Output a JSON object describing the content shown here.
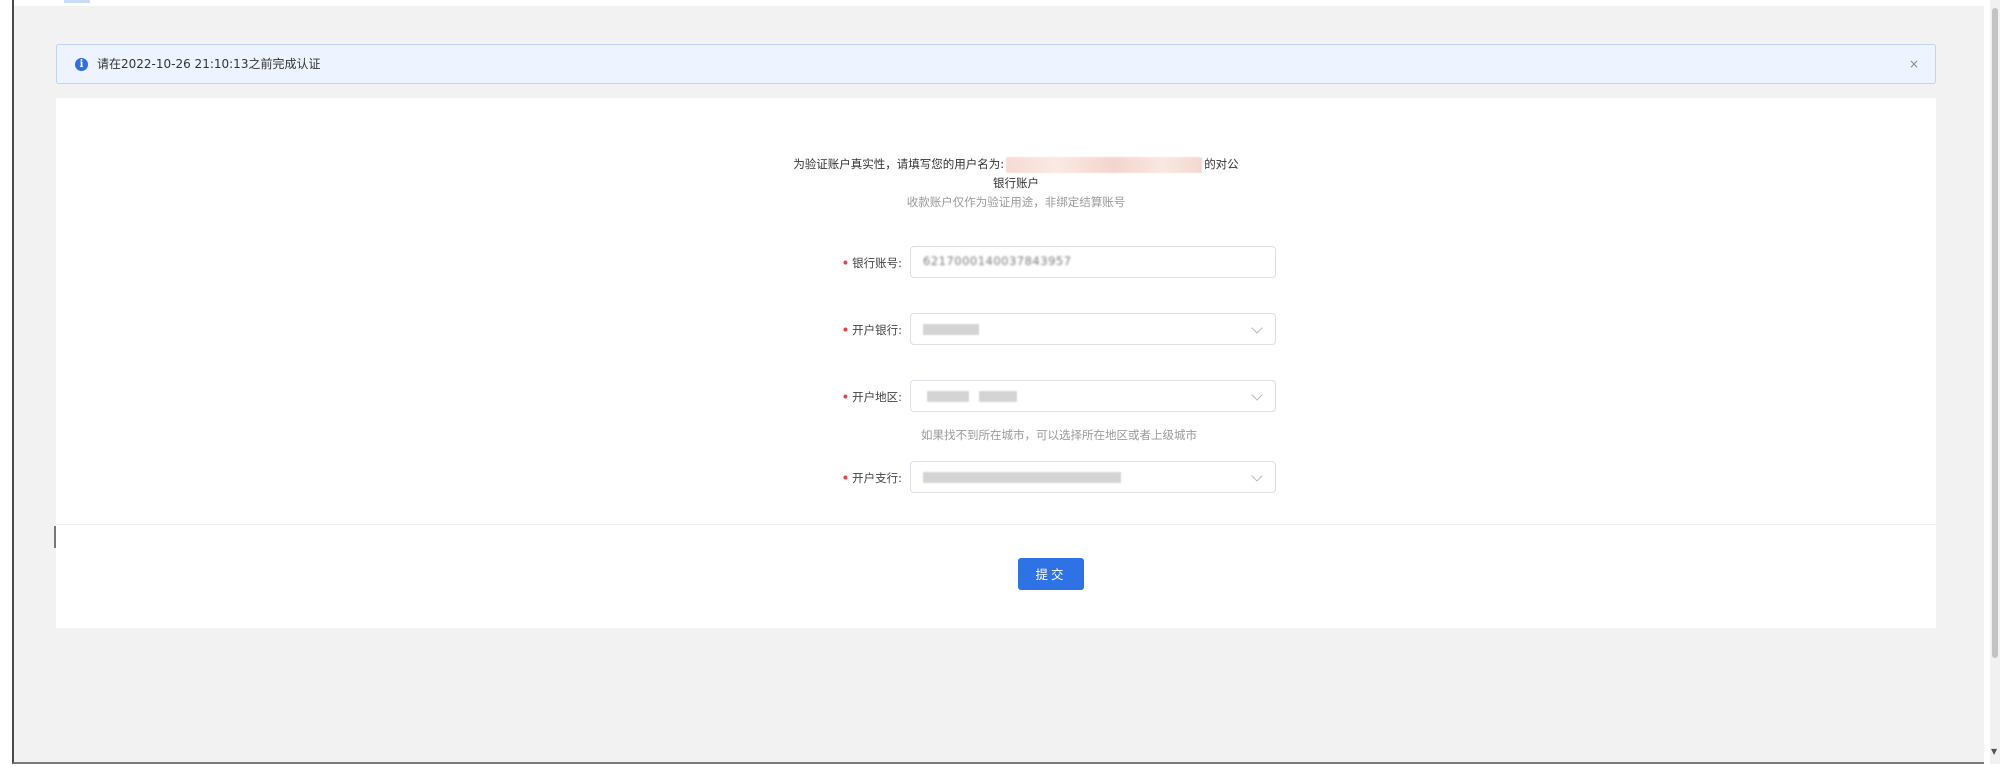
{
  "notice": {
    "text": "请在2022-10-26 21:10:13之前完成认证",
    "close_label": "×",
    "icon": "info-icon"
  },
  "intro": {
    "prefix": "为验证账户真实性，请填写您的用户名为:",
    "suffix": "的对公",
    "line2": "银行账户",
    "line3": "收款账户仅作为验证用途，非绑定结算账号"
  },
  "form": {
    "required_mark": "•",
    "fields": [
      {
        "label": "银行账号:",
        "value": "6217000140037843957",
        "type": "input"
      },
      {
        "label": "开户银行:",
        "type": "select"
      },
      {
        "label": "开户地区:",
        "type": "select"
      },
      {
        "label": "开户支行:",
        "type": "select"
      }
    ],
    "region_hint": "如果找不到所在城市，可以选择所在地区或者上级城市"
  },
  "submit_label": "提交",
  "colors": {
    "accent": "#2e72e6",
    "notice_bg": "#edf4ff",
    "required": "#e0464b"
  }
}
